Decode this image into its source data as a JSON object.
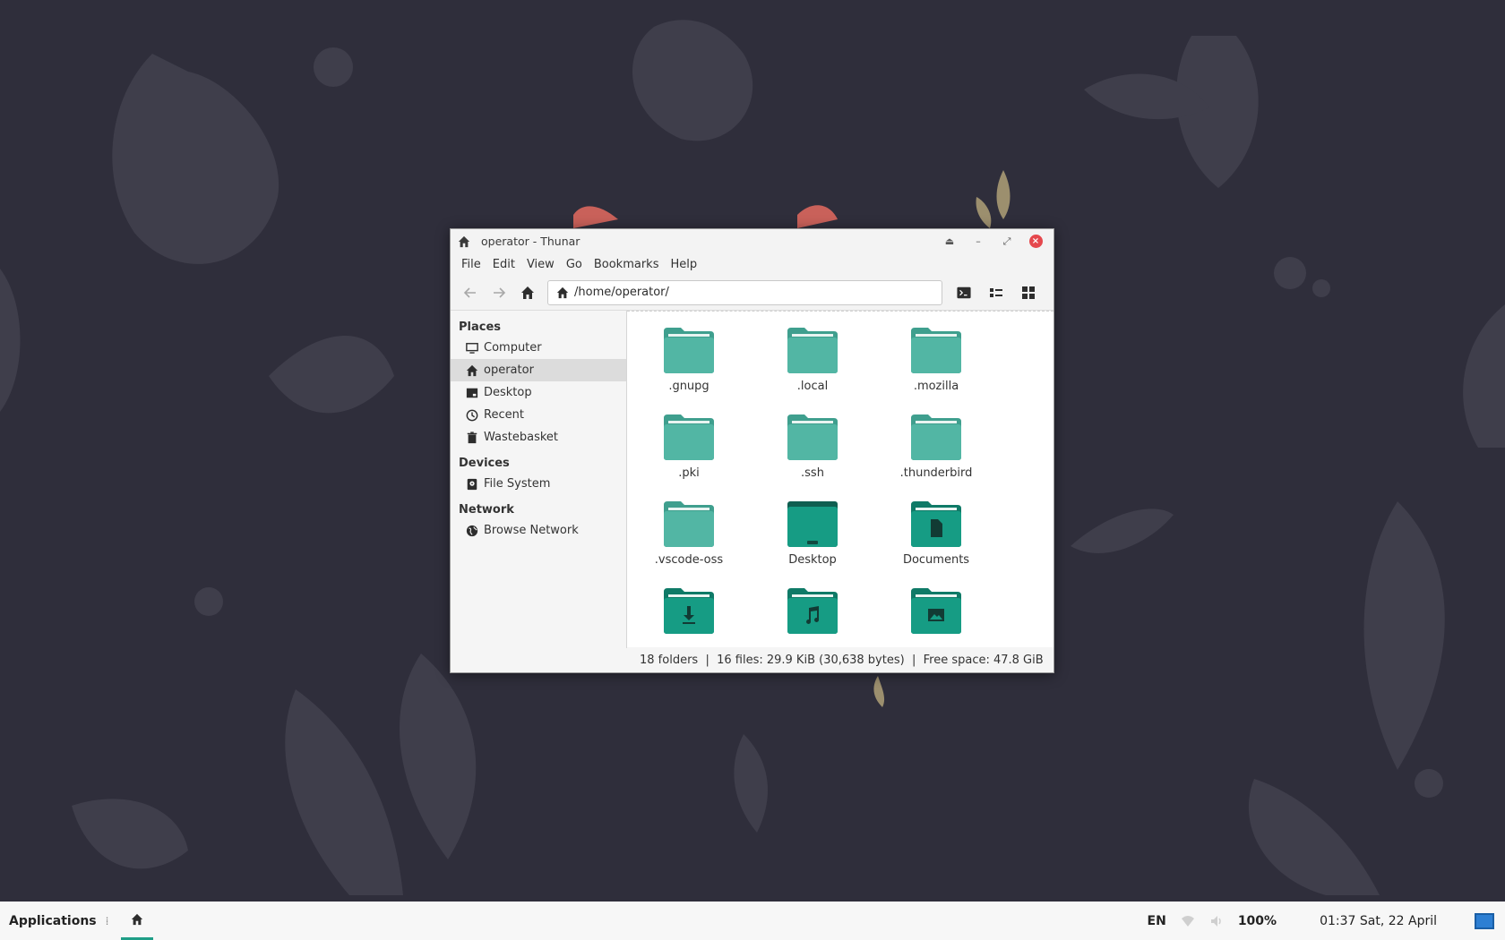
{
  "window": {
    "title": "operator - Thunar"
  },
  "menubar": {
    "items": [
      "File",
      "Edit",
      "View",
      "Go",
      "Bookmarks",
      "Help"
    ]
  },
  "toolbar": {
    "location": "/home/operator/"
  },
  "sidebar": {
    "places_heading": "Places",
    "places": [
      {
        "label": "Computer",
        "icon": "monitor-icon"
      },
      {
        "label": "operator",
        "icon": "home-icon",
        "active": true
      },
      {
        "label": "Desktop",
        "icon": "desktop-icon"
      },
      {
        "label": "Recent",
        "icon": "clock-icon"
      },
      {
        "label": "Wastebasket",
        "icon": "trash-icon"
      }
    ],
    "devices_heading": "Devices",
    "devices": [
      {
        "label": "File System",
        "icon": "disk-icon"
      }
    ],
    "network_heading": "Network",
    "network": [
      {
        "label": "Browse Network",
        "icon": "globe-icon"
      }
    ]
  },
  "files": [
    {
      "name": ".gnupg",
      "icon": "folder-icon"
    },
    {
      "name": ".local",
      "icon": "folder-icon"
    },
    {
      "name": ".mozilla",
      "icon": "folder-icon"
    },
    {
      "name": ".pki",
      "icon": "folder-icon"
    },
    {
      "name": ".ssh",
      "icon": "folder-icon"
    },
    {
      "name": ".thunderbird",
      "icon": "folder-icon"
    },
    {
      "name": ".vscode-oss",
      "icon": "folder-icon"
    },
    {
      "name": "Desktop",
      "icon": "desktop-folder-icon"
    },
    {
      "name": "Documents",
      "icon": "documents-folder-icon"
    },
    {
      "name": "",
      "icon": "downloads-folder-icon"
    },
    {
      "name": "",
      "icon": "music-folder-icon"
    },
    {
      "name": "",
      "icon": "pictures-folder-icon"
    }
  ],
  "statusbar": {
    "text": "18 folders  |  16 files: 29.9 KiB (30,638 bytes)  |  Free space: 47.8 GiB"
  },
  "panel": {
    "applications": "Applications",
    "language": "EN",
    "battery": "100%",
    "clock": "01:37 Sat, 22 April"
  },
  "colors": {
    "desktop_bg": "#2f2e3b",
    "folder_light": "#52b6a4",
    "folder_dark": "#169c84",
    "accent": "#1f9e87",
    "close": "#e5484d"
  }
}
